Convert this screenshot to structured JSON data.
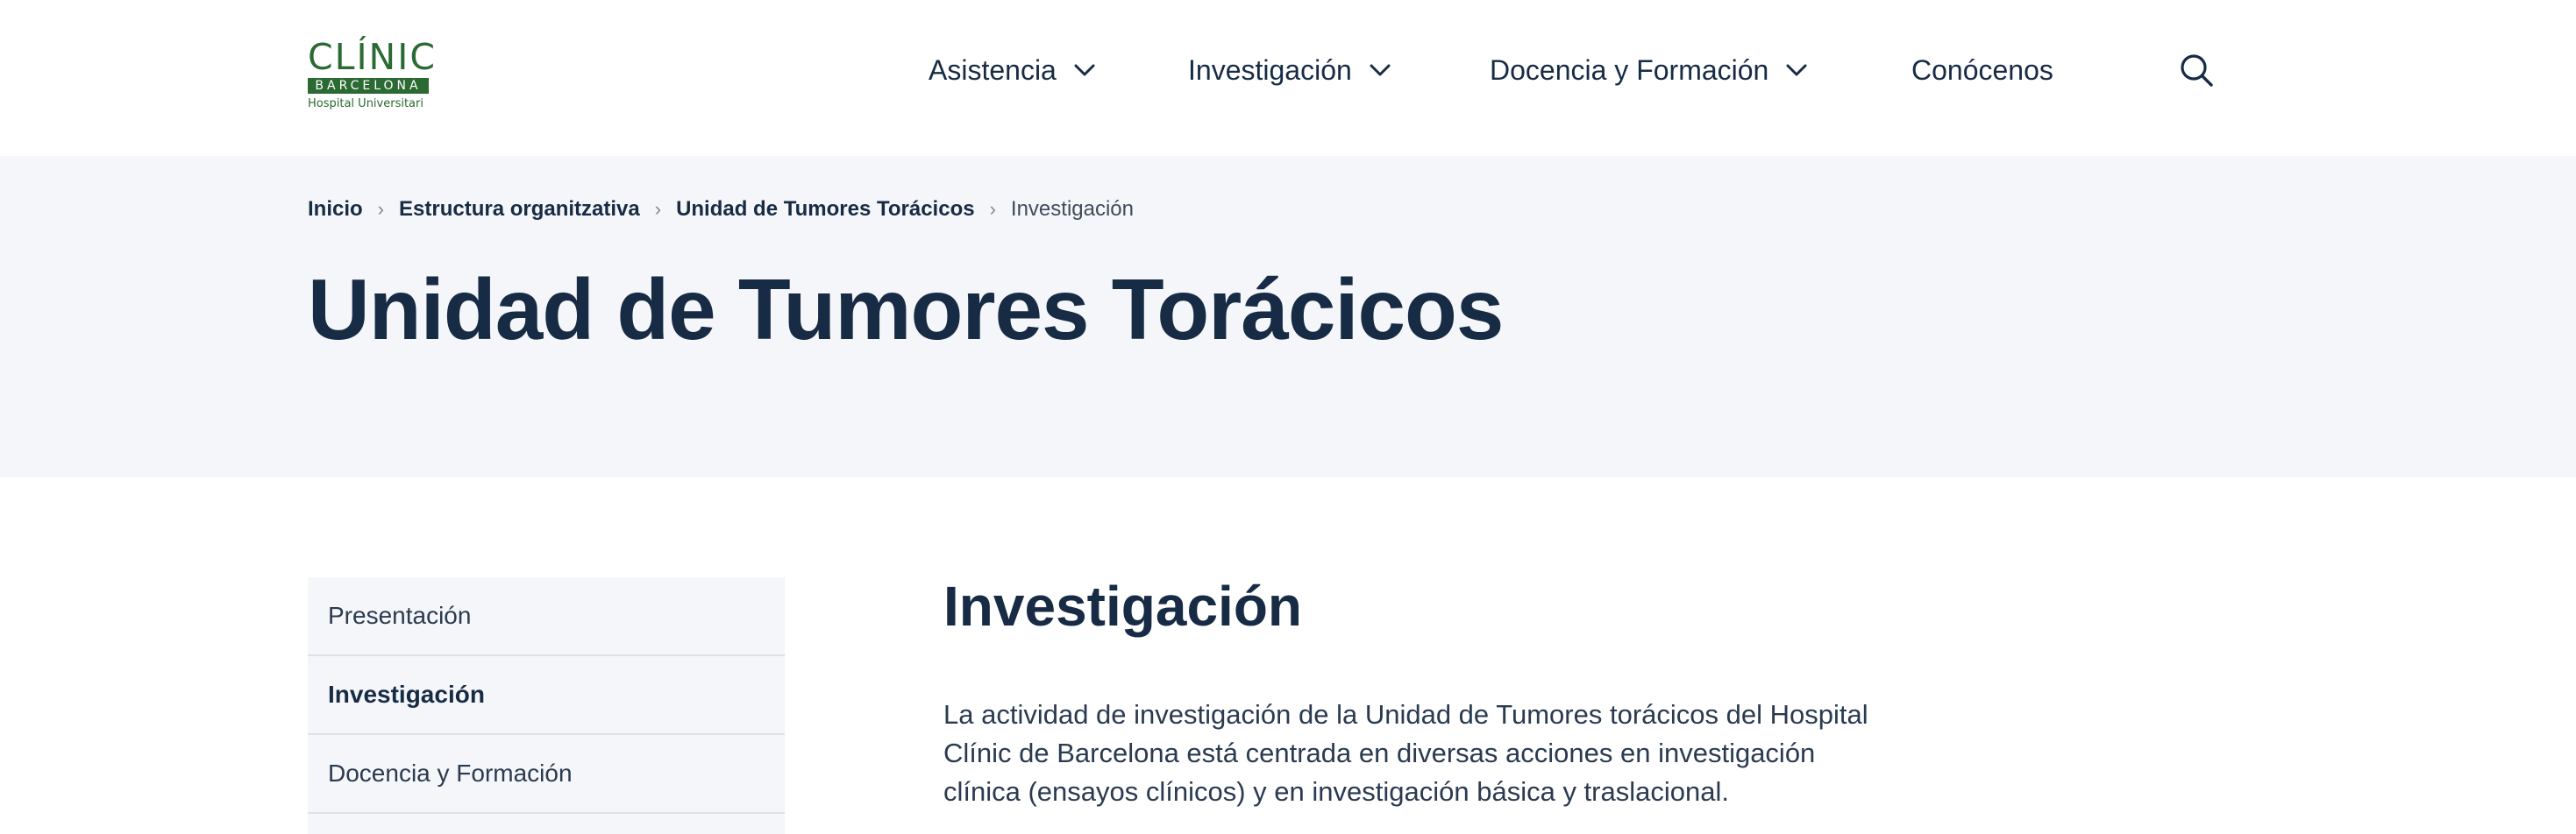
{
  "logo": {
    "word": "CLÍNIC",
    "band": "BARCELONA",
    "sub": "Hospital Universitari"
  },
  "nav": {
    "items": [
      {
        "label": "Asistencia",
        "has_dropdown": true
      },
      {
        "label": "Investigación",
        "has_dropdown": true
      },
      {
        "label": "Docencia y Formación",
        "has_dropdown": true
      },
      {
        "label": "Conócenos",
        "has_dropdown": false
      }
    ],
    "search_icon": "search-icon"
  },
  "breadcrumb": {
    "items": [
      "Inicio",
      "Estructura organitzativa",
      "Unidad de Tumores Torácicos"
    ],
    "current": "Investigación"
  },
  "hero": {
    "title": "Unidad de Tumores Torácicos"
  },
  "sidebar": {
    "items": [
      "Presentación",
      "Investigación",
      "Docencia y Formación"
    ],
    "active": "Investigación"
  },
  "main": {
    "heading": "Investigación",
    "paragraph_lines": [
      "La actividad de investigación de la Unidad de Tumores torácicos del Hospital",
      "Clínic de Barcelona está centrada en diversas acciones en investigación",
      "clínica (ensayos clínicos) y en investigación básica y traslacional."
    ]
  },
  "colors": {
    "brand_green": "#2b6a32",
    "navy_text": "#172b45",
    "hero_bg": "#f4f6f9"
  }
}
